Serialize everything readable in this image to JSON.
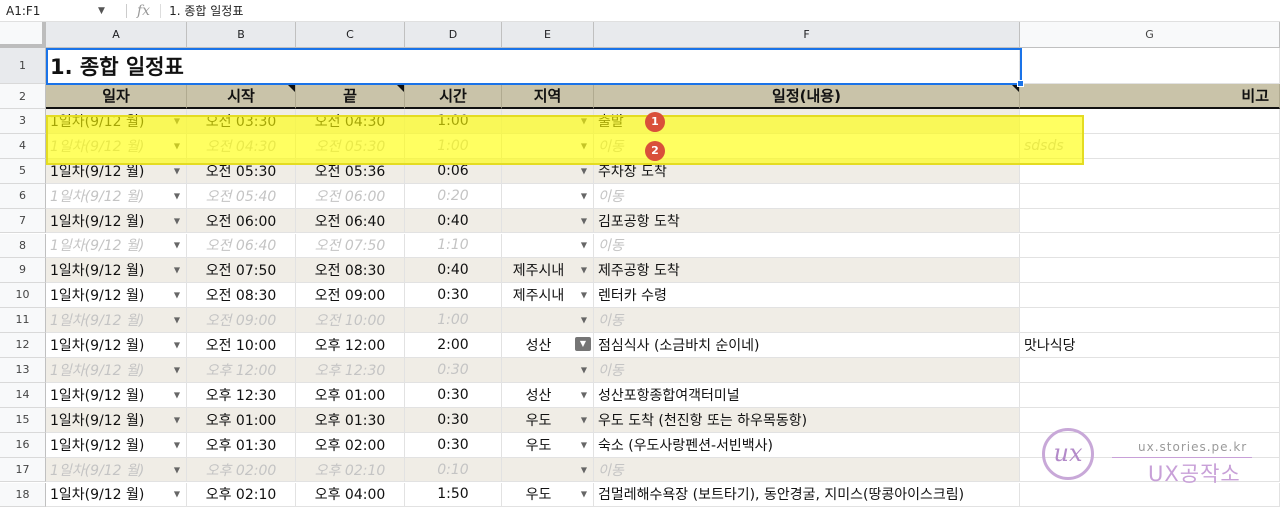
{
  "formula_bar": {
    "name_box": "A1:F1",
    "fx_label": "fx",
    "content": "1. 종합 일정표"
  },
  "columns": [
    "A",
    "B",
    "C",
    "D",
    "E",
    "F",
    "G"
  ],
  "title": "1. 종합 일정표",
  "headers": {
    "day": "일자",
    "start": "시작",
    "end": "끝",
    "duration": "시간",
    "region": "지역",
    "schedule": "일정(내용)",
    "note": "비고"
  },
  "rows": [
    {
      "num": "3",
      "day": "1일차(9/12 월)",
      "start": "오전 03:30",
      "end": "오전 04:30",
      "dur": "1:00",
      "region": "",
      "content": "출발",
      "note": "",
      "faded": false
    },
    {
      "num": "4",
      "day": "1일차(9/12 월)",
      "start": "오전 04:30",
      "end": "오전 05:30",
      "dur": "1:00",
      "region": "",
      "content": "이동",
      "note": "sdsds",
      "faded": true
    },
    {
      "num": "5",
      "day": "1일차(9/12 월)",
      "start": "오전 05:30",
      "end": "오전 05:36",
      "dur": "0:06",
      "region": "",
      "content": "주차장 도착",
      "note": "",
      "faded": false
    },
    {
      "num": "6",
      "day": "1일차(9/12 월)",
      "start": "오전 05:40",
      "end": "오전 06:00",
      "dur": "0:20",
      "region": "",
      "content": "이동",
      "note": "",
      "faded": true
    },
    {
      "num": "7",
      "day": "1일차(9/12 월)",
      "start": "오전 06:00",
      "end": "오전 06:40",
      "dur": "0:40",
      "region": "",
      "content": "김포공항 도착",
      "note": "",
      "faded": false
    },
    {
      "num": "8",
      "day": "1일차(9/12 월)",
      "start": "오전 06:40",
      "end": "오전 07:50",
      "dur": "1:10",
      "region": "",
      "content": "이동",
      "note": "",
      "faded": true
    },
    {
      "num": "9",
      "day": "1일차(9/12 월)",
      "start": "오전 07:50",
      "end": "오전 08:30",
      "dur": "0:40",
      "region": "제주시내",
      "content": "제주공항 도착",
      "note": "",
      "faded": false
    },
    {
      "num": "10",
      "day": "1일차(9/12 월)",
      "start": "오전 08:30",
      "end": "오전 09:00",
      "dur": "0:30",
      "region": "제주시내",
      "content": "렌터카 수령",
      "note": "",
      "faded": false
    },
    {
      "num": "11",
      "day": "1일차(9/12 월)",
      "start": "오전 09:00",
      "end": "오전 10:00",
      "dur": "1:00",
      "region": "",
      "content": "이동",
      "note": "",
      "faded": true
    },
    {
      "num": "12",
      "day": "1일차(9/12 월)",
      "start": "오전 10:00",
      "end": "오후 12:00",
      "dur": "2:00",
      "region": "성산",
      "content": "점심식사 (소금바치 순이네)",
      "note": "맛나식당",
      "faded": false,
      "region_dd_active": true
    },
    {
      "num": "13",
      "day": "1일차(9/12 월)",
      "start": "오후 12:00",
      "end": "오후 12:30",
      "dur": "0:30",
      "region": "",
      "content": "이동",
      "note": "",
      "faded": true
    },
    {
      "num": "14",
      "day": "1일차(9/12 월)",
      "start": "오후 12:30",
      "end": "오후 01:00",
      "dur": "0:30",
      "region": "성산",
      "content": "성산포항종합여객터미널",
      "note": "",
      "faded": false
    },
    {
      "num": "15",
      "day": "1일차(9/12 월)",
      "start": "오후 01:00",
      "end": "오후 01:30",
      "dur": "0:30",
      "region": "우도",
      "content": "우도 도착 (천진항 또는 하우목동항)",
      "note": "",
      "faded": false
    },
    {
      "num": "16",
      "day": "1일차(9/12 월)",
      "start": "오후 01:30",
      "end": "오후 02:00",
      "dur": "0:30",
      "region": "우도",
      "content": "숙소 (우도사랑펜션-서빈백사)",
      "note": "",
      "faded": false
    },
    {
      "num": "17",
      "day": "1일차(9/12 월)",
      "start": "오후 02:00",
      "end": "오후 02:10",
      "dur": "0:10",
      "region": "",
      "content": "이동",
      "note": "",
      "faded": true
    },
    {
      "num": "18",
      "day": "1일차(9/12 월)",
      "start": "오후 02:10",
      "end": "오후 04:00",
      "dur": "1:50",
      "region": "우도",
      "content": "검멀레해수욕장 (보트타기), 동안경굴, 지미스(땅콩아이스크림)",
      "note": "",
      "faded": false
    }
  ],
  "row1_num": "1",
  "row2_num": "2",
  "badges": [
    "1",
    "2"
  ],
  "watermark": {
    "logo": "ux",
    "url": "ux.stories.pe.kr",
    "name": "UX공작소"
  },
  "colors": {
    "header_bg": "#c9c3a9",
    "row_alt_bg": "#f0ede6",
    "highlight": "#ffff00",
    "selection": "#1a73e8",
    "badge": "#d9503a"
  },
  "icons": {
    "dropdown": "dropdown-arrow-icon",
    "fx": "fx-icon"
  }
}
